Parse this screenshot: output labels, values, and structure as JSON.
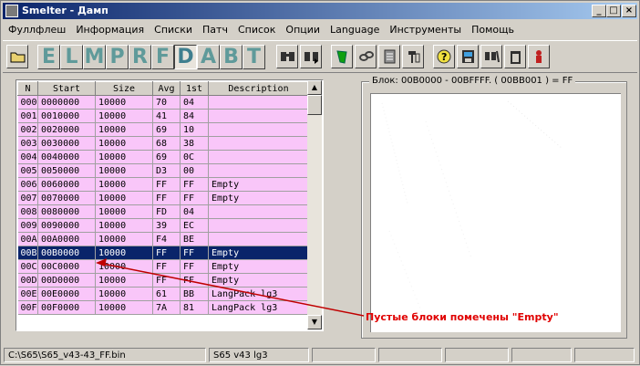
{
  "window": {
    "title": "Smelter - Дамп",
    "minimize": "_",
    "maximize": "□",
    "close": "×"
  },
  "menu": [
    "Фуллфлеш",
    "Информация",
    "Списки",
    "Патч",
    "Список",
    "Опции",
    "Language",
    "Инструменты",
    "Помощь"
  ],
  "toolbar": {
    "letters": [
      "E",
      "L",
      "M",
      "P",
      "R",
      "F",
      "D",
      "A",
      "B",
      "T"
    ],
    "active_letter": "D",
    "icons": [
      "open-folder-icon",
      "binoculars-icon",
      "binoculars-go-icon",
      "green-phone-icon",
      "chain-icon",
      "grid-doc-icon",
      "hammer-icon",
      "question-icon",
      "disk-icon",
      "search-tools-icon",
      "trash-icon",
      "exit-icon"
    ]
  },
  "table": {
    "columns": [
      "N",
      "Start",
      "Size",
      "Avg",
      "1st",
      "Description"
    ],
    "rows": [
      [
        "000",
        "0000000",
        "10000",
        "70",
        "04",
        ""
      ],
      [
        "001",
        "0010000",
        "10000",
        "41",
        "84",
        ""
      ],
      [
        "002",
        "0020000",
        "10000",
        "69",
        "10",
        ""
      ],
      [
        "003",
        "0030000",
        "10000",
        "68",
        "38",
        ""
      ],
      [
        "004",
        "0040000",
        "10000",
        "69",
        "0C",
        ""
      ],
      [
        "005",
        "0050000",
        "10000",
        "D3",
        "00",
        ""
      ],
      [
        "006",
        "0060000",
        "10000",
        "FF",
        "FF",
        "Empty"
      ],
      [
        "007",
        "0070000",
        "10000",
        "FF",
        "FF",
        "Empty"
      ],
      [
        "008",
        "0080000",
        "10000",
        "FD",
        "04",
        ""
      ],
      [
        "009",
        "0090000",
        "10000",
        "39",
        "EC",
        ""
      ],
      [
        "00A",
        "00A0000",
        "10000",
        "F4",
        "BE",
        ""
      ],
      [
        "00B",
        "00B0000",
        "10000",
        "FF",
        "FF",
        "Empty"
      ],
      [
        "00C",
        "00C0000",
        "10000",
        "FF",
        "FF",
        "Empty"
      ],
      [
        "00D",
        "00D0000",
        "10000",
        "FF",
        "FF",
        "Empty"
      ],
      [
        "00E",
        "00E0000",
        "10000",
        "61",
        "BB",
        "LangPack lg3"
      ],
      [
        "00F",
        "00F0000",
        "10000",
        "7A",
        "81",
        "LangPack lg3"
      ]
    ],
    "selected_row": 11
  },
  "block_panel": {
    "caption": "Блок: 00B0000 - 00BFFFF.    ( 00BB001 ) = FF"
  },
  "annotation": {
    "text": "Пустые блоки помечены \"Empty\"",
    "color": "#e00000"
  },
  "status": {
    "file": "C:\\S65\\S65_v43-43_FF.bin",
    "model": "S65 v43 lg3"
  },
  "colors": {
    "row_bg": "#f9c6f9",
    "selection": "#0a246a",
    "title_bar": "#0a246a",
    "letter": "#5f9a9a"
  }
}
